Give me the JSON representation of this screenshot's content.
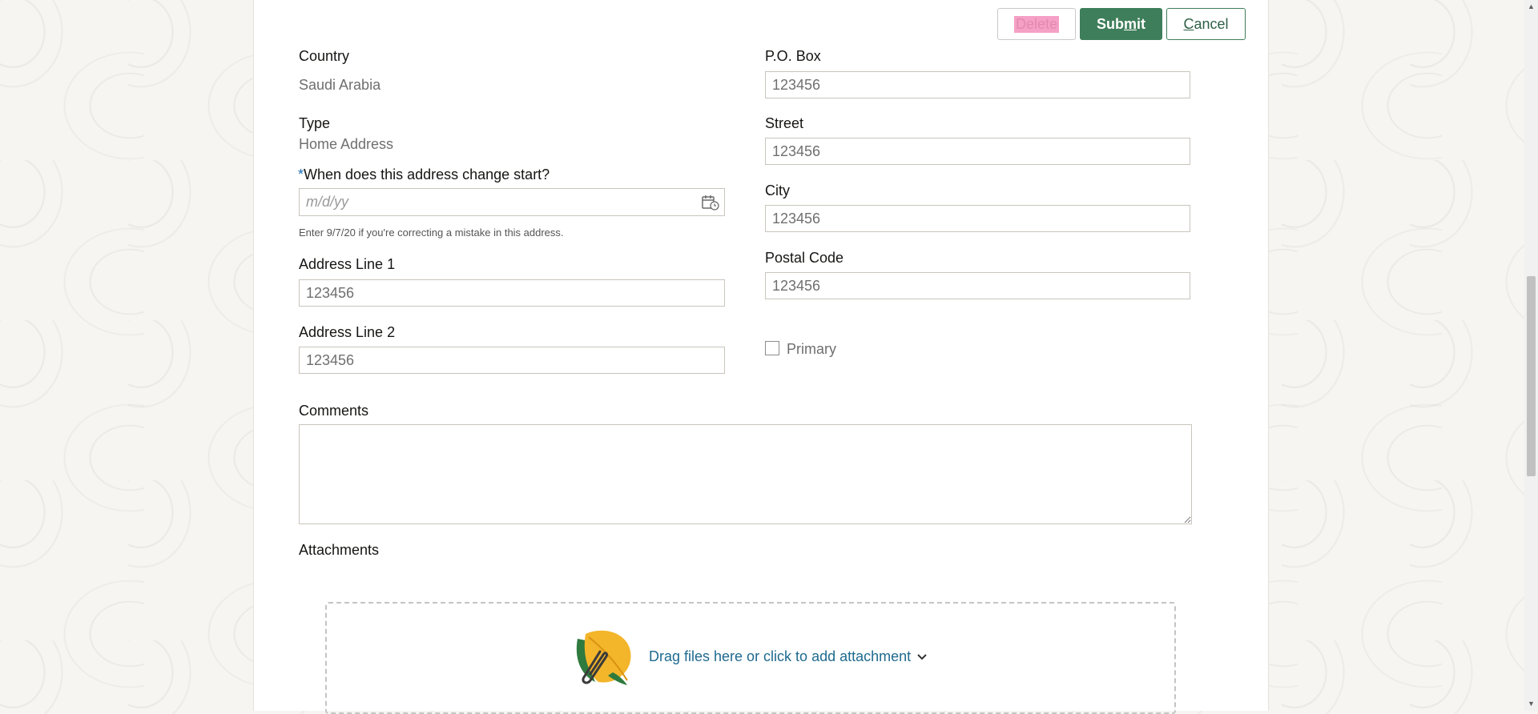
{
  "toolbar": {
    "delete_label": "Delete",
    "submit_label_pre": "Sub",
    "submit_label_mnemonic": "m",
    "submit_label_post": "it",
    "cancel_label_mnemonic": "C",
    "cancel_label_post": "ancel"
  },
  "form": {
    "country": {
      "label": "Country",
      "value": "Saudi Arabia"
    },
    "type": {
      "label": "Type",
      "value": "Home Address"
    },
    "start_date": {
      "required_mark": "*",
      "label": "When does this address change start?",
      "placeholder": "m/d/yy",
      "hint": "Enter 9/7/20 if you're correcting a mistake in this address."
    },
    "address_line_1": {
      "label": "Address Line 1",
      "value": "123456"
    },
    "address_line_2": {
      "label": "Address Line 2",
      "value": "123456"
    },
    "po_box": {
      "label": "P.O. Box",
      "value": "123456"
    },
    "street": {
      "label": "Street",
      "value": "123456"
    },
    "city": {
      "label": "City",
      "value": "123456"
    },
    "postal_code": {
      "label": "Postal Code",
      "value": "123456"
    },
    "primary": {
      "label": "Primary",
      "checked": false
    },
    "comments": {
      "label": "Comments",
      "value": ""
    }
  },
  "attachments": {
    "label": "Attachments",
    "dropzone_text": "Drag files here or click to add attachment"
  },
  "colors": {
    "accent_green": "#3f7e5b",
    "link_blue": "#1f6a8f",
    "required_blue": "#1c6fb5"
  },
  "icons": [
    "calendar-icon",
    "attachment-leaf-icon",
    "chevron-down-icon",
    "scroll-up-arrow-icon",
    "scroll-down-arrow-icon"
  ]
}
